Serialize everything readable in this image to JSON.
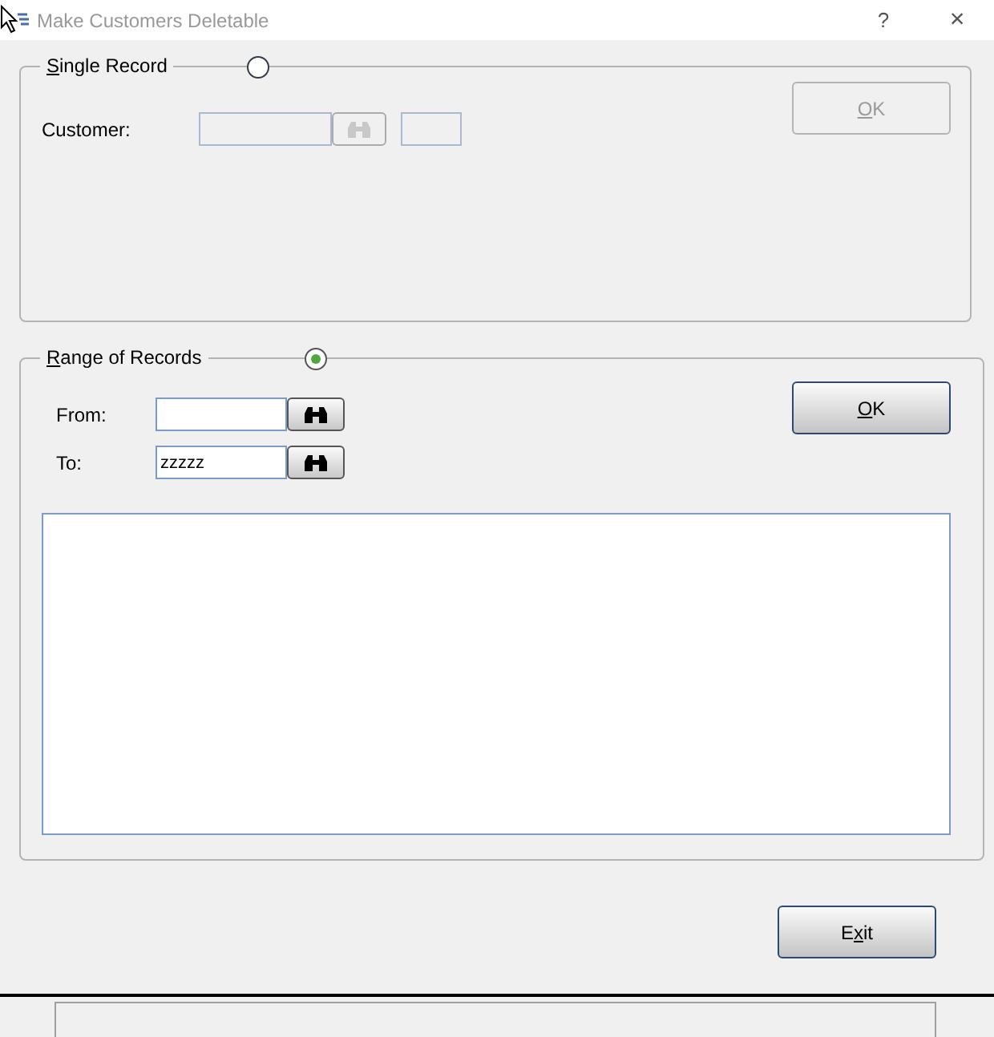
{
  "window": {
    "title": "Make Customers Deletable",
    "help": "?",
    "close": "×"
  },
  "single_record": {
    "label": {
      "key": "S",
      "after": "ingle Record"
    },
    "selected": false,
    "customer_label": "Customer:",
    "disabled": true,
    "ok": {
      "key": "O",
      "after": "K",
      "disabled": true
    }
  },
  "range": {
    "label": {
      "key": "R",
      "after": "ange of Records"
    },
    "selected": true,
    "from_label": "From:",
    "to_label": "To:",
    "to_value": "zzzzz",
    "ok": {
      "key": "O",
      "after": "K",
      "disabled": false
    }
  },
  "exit": {
    "before": "E",
    "key": "x",
    "after": "it"
  }
}
